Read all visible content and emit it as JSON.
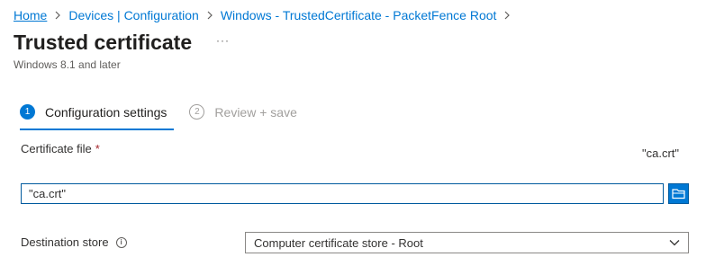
{
  "breadcrumb": {
    "items": [
      {
        "label": "Home"
      },
      {
        "label": "Devices | Configuration"
      },
      {
        "label": "Windows - TrustedCertificate - PacketFence Root"
      }
    ]
  },
  "header": {
    "title": "Trusted certificate",
    "more_label": "···",
    "subtitle": "Windows 8.1 and later"
  },
  "wizard": {
    "steps": [
      {
        "number": "1",
        "label": "Configuration settings",
        "state": "active"
      },
      {
        "number": "2",
        "label": "Review + save",
        "state": "inactive"
      }
    ]
  },
  "certificate_file": {
    "label": "Certificate file",
    "required_mark": "*",
    "selected_name": "\"ca.crt\"",
    "input_value": "\"ca.crt\""
  },
  "destination_store": {
    "label": "Destination store",
    "info_icon": "i",
    "selected": "Computer certificate store - Root"
  },
  "colors": {
    "accent": "#0078d4",
    "required": "#a4262c"
  },
  "icons": {
    "breadcrumb_separator": "chevron-right-icon",
    "browse": "folder-open-icon",
    "info": "info-icon",
    "dropdown": "chevron-down-icon"
  }
}
